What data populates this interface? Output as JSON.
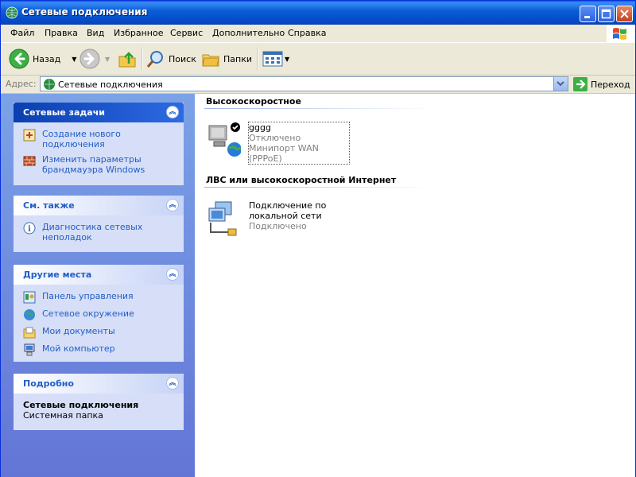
{
  "window": {
    "title": "Сетевые подключения"
  },
  "menu": [
    "Файл",
    "Правка",
    "Вид",
    "Избранное",
    "Сервис",
    "Дополнительно",
    "Справка"
  ],
  "toolbar": {
    "back_label": "Назад",
    "search_label": "Поиск",
    "folders_label": "Папки"
  },
  "address": {
    "label": "Адрес:",
    "value": "Сетевые подключения",
    "go_label": "Переход"
  },
  "left_panels": {
    "tasks": {
      "title": "Сетевые задачи",
      "items": [
        {
          "label": "Создание нового подключения",
          "icon": "new-connection-icon"
        },
        {
          "label": "Изменить параметры брандмауэра Windows",
          "icon": "firewall-icon"
        }
      ]
    },
    "see_also": {
      "title": "См. также",
      "items": [
        {
          "label": "Диагностика сетевых неполадок",
          "icon": "info-icon"
        }
      ]
    },
    "other_places": {
      "title": "Другие места",
      "items": [
        {
          "label": "Панель управления",
          "icon": "control-panel-icon"
        },
        {
          "label": "Сетевое окружение",
          "icon": "network-places-icon"
        },
        {
          "label": "Мои документы",
          "icon": "my-documents-icon"
        },
        {
          "label": "Мой компьютер",
          "icon": "my-computer-icon"
        }
      ]
    },
    "details": {
      "title": "Подробно",
      "name": "Сетевые подключения",
      "type": "Системная папка"
    }
  },
  "groups": {
    "broadband": {
      "title": "Высокоскоростное",
      "connection": {
        "name": "gggg",
        "status": "Отключено",
        "device": "Минипорт WAN (PPPoE)"
      }
    },
    "lan": {
      "title": "ЛВС или высокоскоростной Интернет",
      "connection": {
        "name": "Подключение по локальной сети",
        "status": "Подключено"
      }
    }
  }
}
